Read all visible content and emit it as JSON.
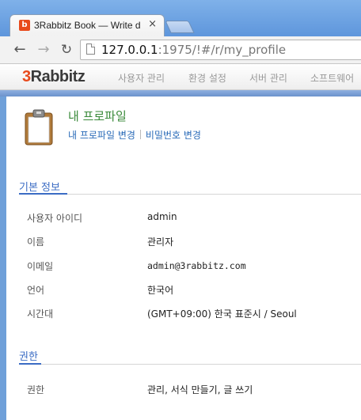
{
  "browser": {
    "tab_title": "3Rabbitz Book — Write d",
    "tab_close": "×",
    "favicon_letter": "b",
    "url_host": "127.0.0.1",
    "url_rest": ":1975/!#/r/my_profile",
    "back_glyph": "←",
    "forward_glyph": "→",
    "reload_glyph": "↻"
  },
  "app": {
    "logo_prefix": "3",
    "logo_rest": "Rabbitz",
    "menu": [
      {
        "label": "사용자 관리"
      },
      {
        "label": "환경 설정"
      },
      {
        "label": "서버 관리"
      },
      {
        "label": "소프트웨어"
      }
    ]
  },
  "profile": {
    "title": "내 프로파일",
    "links": {
      "edit_profile": "내 프로파일 변경",
      "change_password": "비밀번호 변경"
    }
  },
  "basic_info": {
    "header": "기본 정보",
    "rows": [
      {
        "label": "사용자 아이디",
        "value": "admin"
      },
      {
        "label": "이름",
        "value": "관리자"
      },
      {
        "label": "이메일",
        "value": "admin@3rabbitz.com"
      },
      {
        "label": "언어",
        "value": "한국어"
      },
      {
        "label": "시간대",
        "value": "(GMT+09:00) 한국 표준시 / Seoul"
      }
    ]
  },
  "permissions": {
    "header": "권한",
    "rows": [
      {
        "label": "권한",
        "value": "관리, 서식 만들기, 글 쓰기"
      }
    ]
  },
  "colors": {
    "accent_blue": "#3b6cc4",
    "title_green": "#3a8a3a",
    "link_blue": "#2a6bb8",
    "logo_orange": "#e84a1c"
  }
}
